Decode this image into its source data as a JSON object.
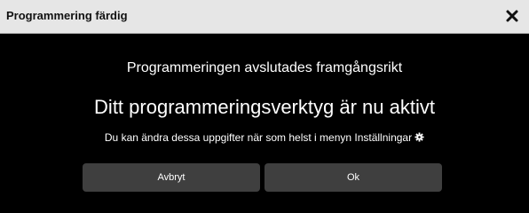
{
  "dialog": {
    "title": "Programmering färdig",
    "close_icon": "close-icon",
    "message_line1": "Programmeringen avslutades framgångsrikt",
    "message_line2": "Ditt programmeringsverktyg är nu aktivt",
    "message_line3": "Du kan ändra dessa uppgifter när som helst i menyn Inställningar",
    "settings_icon": "gear-icon",
    "cancel_label": "Avbryt",
    "ok_label": "Ok"
  },
  "colors": {
    "titlebar": "#e6e6e6",
    "background": "#000000",
    "button": "#3f3f3f",
    "text": "#ffffff"
  }
}
